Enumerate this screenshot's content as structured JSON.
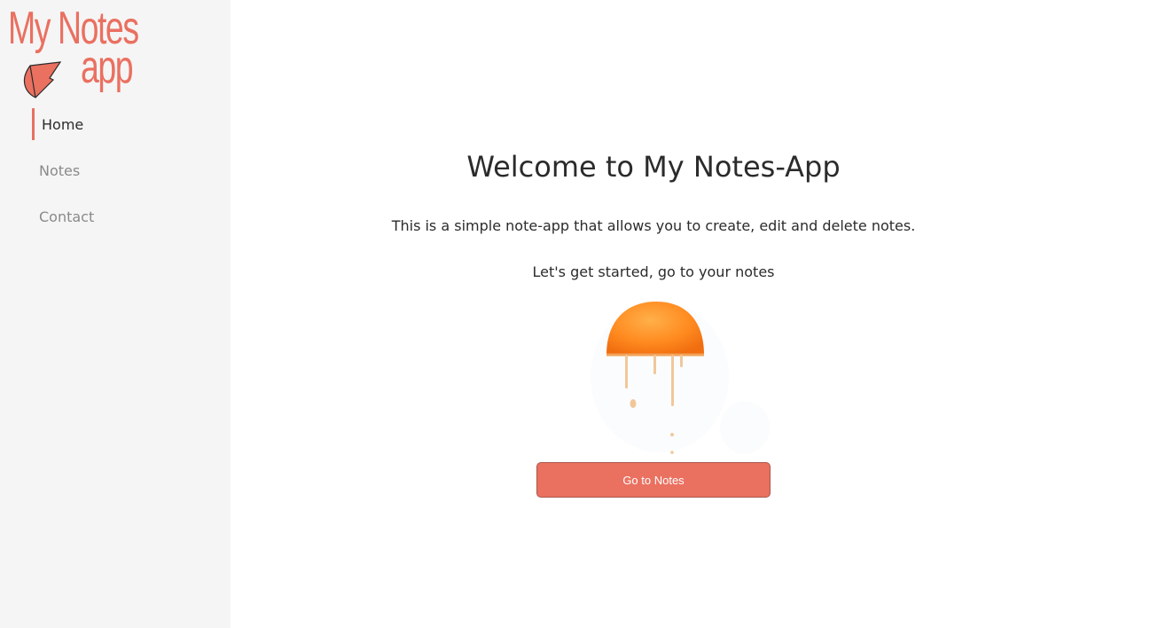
{
  "sidebar": {
    "logo": {
      "line1": "My Notes",
      "line2": "app"
    },
    "nav": [
      {
        "label": "Home",
        "active": true
      },
      {
        "label": "Notes",
        "active": false
      },
      {
        "label": "Contact",
        "active": false
      }
    ]
  },
  "main": {
    "title": "Welcome to My Notes-App",
    "description": "This is a simple note-app that allows you to create, edit and delete notes.",
    "prompt": "Let's get started, go to your notes",
    "illustration": "dripping-orange-half",
    "button_label": "Go to Notes"
  },
  "colors": {
    "accent": "#ea7060",
    "sidebar_bg": "#f5f5f5",
    "text_dark": "#2b2b2b",
    "text_muted": "#8a8a8a"
  }
}
